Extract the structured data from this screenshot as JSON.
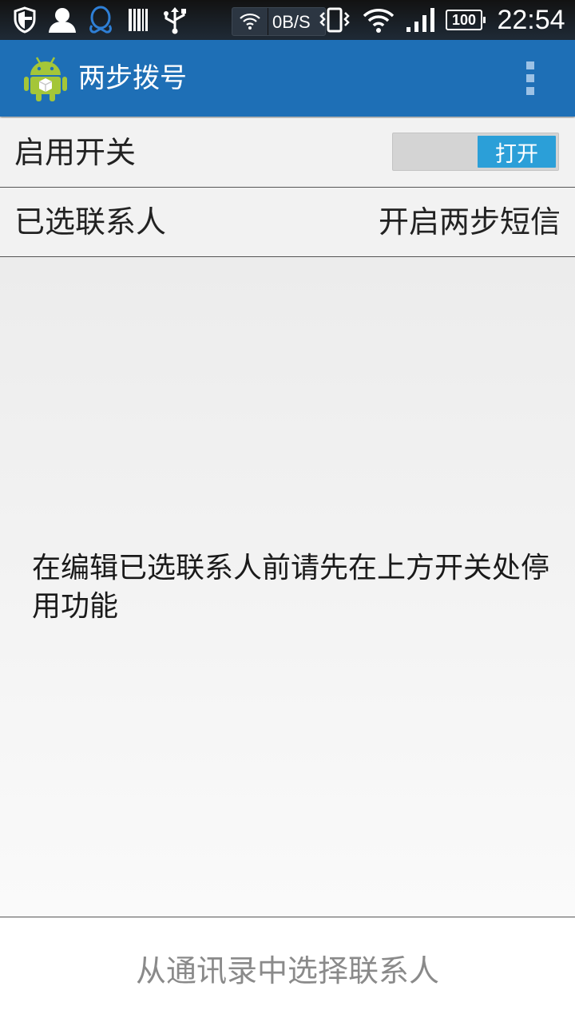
{
  "status_bar": {
    "net_speed": "0B/S",
    "battery": "100",
    "time": "22:54",
    "icons": [
      "shield-icon",
      "contact-icon",
      "qq-icon",
      "barcode-icon",
      "usb-icon",
      "wifi-icon",
      "vibrate-icon",
      "wifi-icon",
      "signal-icon",
      "battery-icon"
    ]
  },
  "action_bar": {
    "title": "两步拨号",
    "app_icon": "android-icon",
    "overflow_icon": "overflow-menu-icon"
  },
  "enable_row": {
    "label": "启用开关",
    "toggle_label": "打开",
    "toggle_on": true
  },
  "contacts_row": {
    "label": "已选联系人",
    "right_label": "开启两步短信"
  },
  "notice": {
    "text": "在编辑已选联系人前请先在上方开关处停用功能"
  },
  "bottom": {
    "button_label": "从通讯录中选择联系人"
  },
  "colors": {
    "action_bar": "#1e6fb6",
    "toggle_on": "#2b9fd8",
    "background": "#f2f2f2",
    "disabled_text": "#8a8a8a"
  }
}
